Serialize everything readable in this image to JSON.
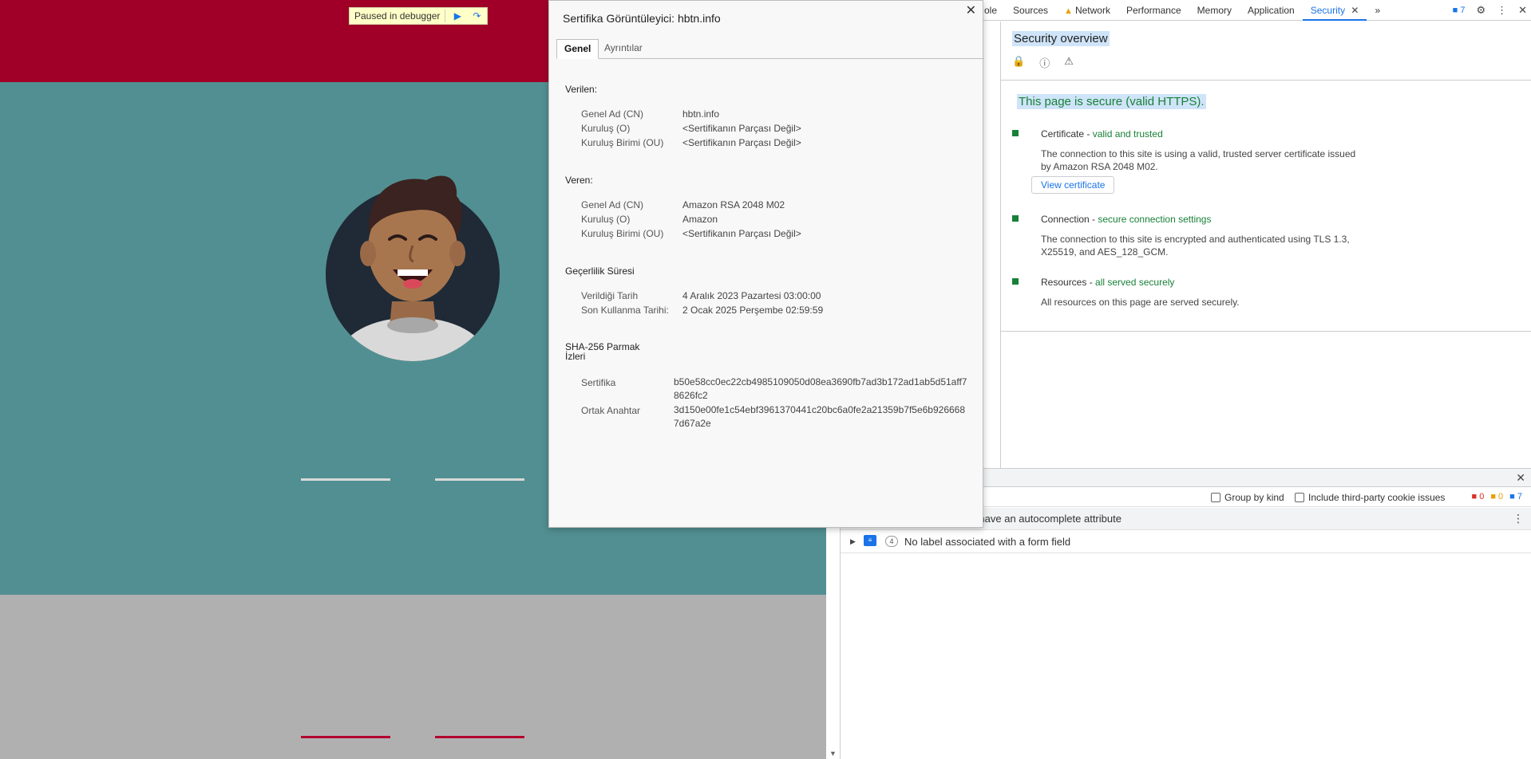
{
  "debugger": {
    "label": "Paused in debugger"
  },
  "devtools": {
    "tabs": [
      {
        "label": "ole"
      },
      {
        "label": "Sources"
      },
      {
        "label": "Network"
      },
      {
        "label": "Performance"
      },
      {
        "label": "Memory"
      },
      {
        "label": "Application"
      },
      {
        "label": "Security"
      }
    ],
    "more_tabs": "»",
    "issues_badge": "7",
    "security": {
      "title": "Security overview",
      "page_status": "This page is secure (valid HTTPS).",
      "certificate": {
        "head": "Certificate - ",
        "status": "valid and trusted",
        "desc": "The connection to this site is using a valid, trusted server certificate issued by Amazon RSA 2048 M02.",
        "button": "View certificate"
      },
      "connection": {
        "head": "Connection - ",
        "status": "secure connection settings",
        "desc": "The connection to this site is encrypted and authenticated using TLS 1.3, X25519, and AES_128_GCM."
      },
      "resources": {
        "head": "Resources - ",
        "status": "all served securely",
        "desc": "All resources on this page are served securely."
      }
    },
    "drawer": {
      "group_by_kind": "Group by kind",
      "third_party": "Include third-party cookie issues",
      "errors": "0",
      "warnings": "0",
      "info": "7",
      "issues": [
        {
          "text": "sn't have an autocomplete attribute"
        },
        {
          "count": "4",
          "text": "No label associated with a form field"
        }
      ]
    }
  },
  "cert": {
    "title": "Sertifika Görüntüleyici: hbtn.info",
    "tabs": [
      "Genel",
      "Ayrıntılar"
    ],
    "issued_to": {
      "heading": "Verilen:",
      "cn_label": "Genel Ad (CN)",
      "cn": "hbtn.info",
      "o_label": "Kuruluş (O)",
      "o": "<Sertifikanın Parçası Değil>",
      "ou_label": "Kuruluş Birimi (OU)",
      "ou": "<Sertifikanın Parçası Değil>"
    },
    "issued_by": {
      "heading": "Veren:",
      "cn_label": "Genel Ad (CN)",
      "cn": "Amazon RSA 2048 M02",
      "o_label": "Kuruluş (O)",
      "o": "Amazon",
      "ou_label": "Kuruluş Birimi (OU)",
      "ou": "<Sertifikanın Parçası Değil>"
    },
    "validity": {
      "heading": "Geçerlilik Süresi",
      "issued_label": "Verildiği Tarih",
      "issued": "4 Aralık 2023 Pazartesi 03:00:00",
      "expires_label": "Son Kullanma Tarihi:",
      "expires": "2 Ocak 2025 Perşembe 02:59:59"
    },
    "fingerprints": {
      "heading_1": "SHA-256 Parmak",
      "heading_2": "İzleri",
      "cert_label": "Sertifika",
      "cert": "b50e58cc0ec22cb4985109050d08ea3690fb7ad3b172ad1ab5d51aff78626fc2",
      "key_label": "Ortak Anahtar",
      "key": "3d150e00fe1c54ebf3961370441c20bc6a0fe2a21359b7f5e6b9266687d67a2e"
    }
  }
}
